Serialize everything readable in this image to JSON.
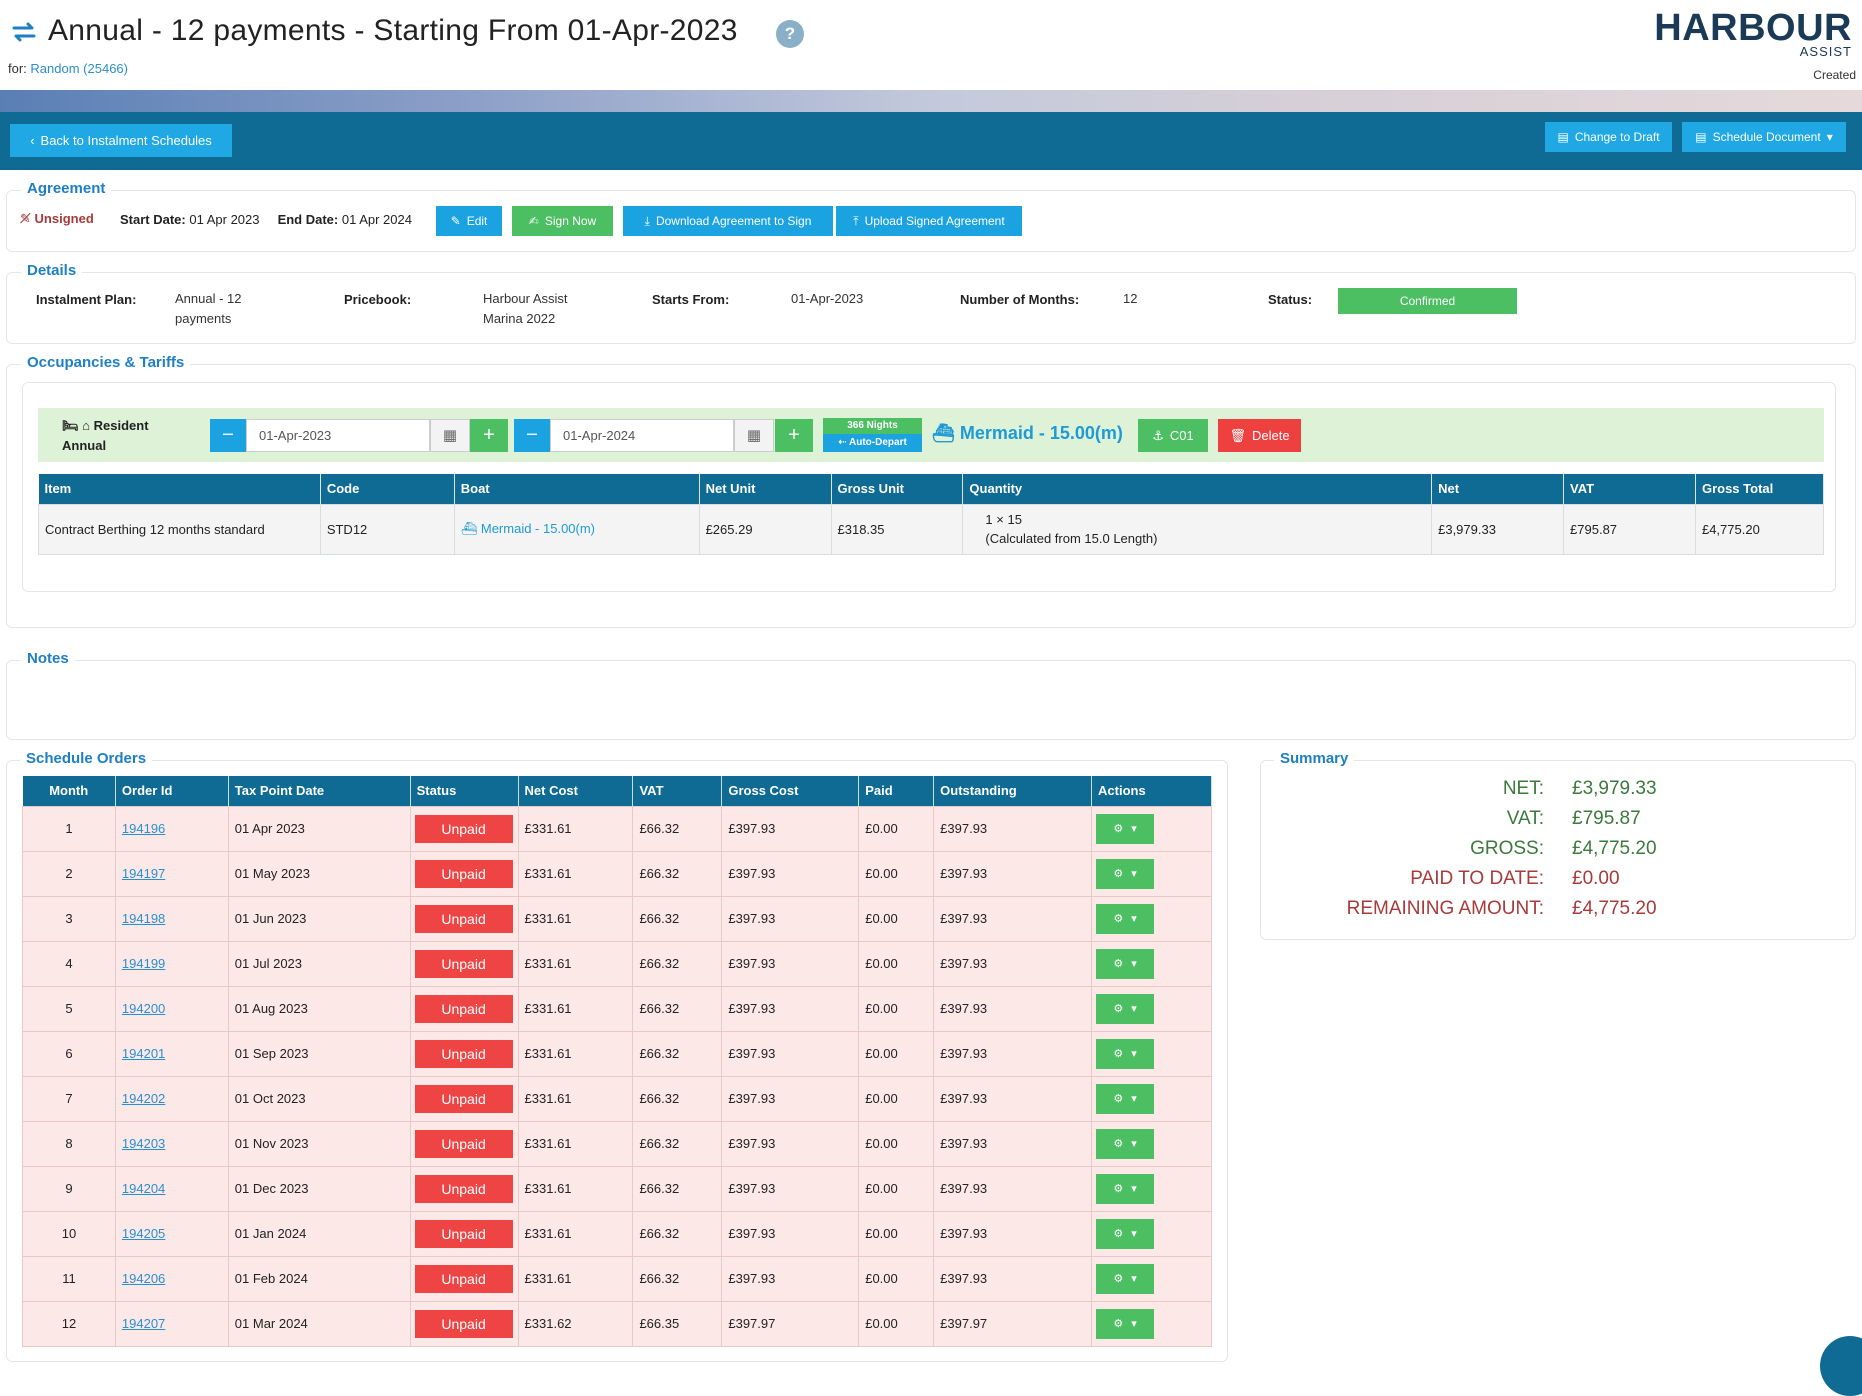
{
  "header": {
    "title": "Annual - 12 payments - Starting From 01-Apr-2023",
    "help_label": "?",
    "for_label": "for:",
    "for_link": "Random (25466)",
    "logo_main": "HARBOUR",
    "logo_sub": "ASSIST",
    "status_text": "Created"
  },
  "toolbar": {
    "back_label": "Back to Instalment Schedules",
    "change_draft_label": "Change to Draft",
    "schedule_document_label": "Schedule Document"
  },
  "agreement": {
    "legend": "Agreement",
    "unsigned_label": "Unsigned",
    "start_label": "Start Date:",
    "start_value": "01 Apr 2023",
    "end_label": "End Date:",
    "end_value": "01 Apr 2024",
    "edit_label": "Edit",
    "sign_now_label": "Sign Now",
    "download_label": "Download Agreement to Sign",
    "upload_label": "Upload Signed Agreement"
  },
  "details": {
    "legend": "Details",
    "plan_label": "Instalment Plan:",
    "plan_value_1": "Annual - 12",
    "plan_value_2": "payments",
    "pricebook_label": "Pricebook:",
    "pricebook_value_1": "Harbour Assist",
    "pricebook_value_2": "Marina 2022",
    "starts_label": "Starts From:",
    "starts_value": "01-Apr-2023",
    "months_label": "Number of Months:",
    "months_value": "12",
    "status_label": "Status:",
    "status_value": "Confirmed"
  },
  "occupancy": {
    "legend": "Occupancies & Tariffs",
    "type_1": "Resident",
    "type_2": "Annual",
    "start_date": "01-Apr-2023",
    "end_date": "01-Apr-2024",
    "nights_label": "366 Nights",
    "auto_depart_label": "Auto-Depart",
    "boat_label": "Mermaid - 15.00(m)",
    "berth_label": "C01",
    "delete_label": "Delete",
    "columns": [
      "Item",
      "Code",
      "Boat",
      "Net Unit",
      "Gross Unit",
      "Quantity",
      "Net",
      "VAT",
      "Gross Total"
    ],
    "row": {
      "item": "Contract Berthing 12 months standard",
      "code": "STD12",
      "boat": "Mermaid - 15.00(m)",
      "net_unit": "£265.29",
      "gross_unit": "£318.35",
      "quantity_1": "1 × 15",
      "quantity_2": "(Calculated from 15.0 Length)",
      "net": "£3,979.33",
      "vat": "£795.87",
      "gross_total": "£4,775.20"
    }
  },
  "notes": {
    "legend": "Notes"
  },
  "schedule": {
    "legend": "Schedule Orders",
    "columns": [
      "Month",
      "Order Id",
      "Tax Point Date",
      "Status",
      "Net Cost",
      "VAT",
      "Gross Cost",
      "Paid",
      "Outstanding",
      "Actions"
    ],
    "rows": [
      {
        "month": "1",
        "order_id": "194196",
        "date": "01 Apr 2023",
        "status": "Unpaid",
        "net": "£331.61",
        "vat": "£66.32",
        "gross": "£397.93",
        "paid": "£0.00",
        "outstanding": "£397.93"
      },
      {
        "month": "2",
        "order_id": "194197",
        "date": "01 May 2023",
        "status": "Unpaid",
        "net": "£331.61",
        "vat": "£66.32",
        "gross": "£397.93",
        "paid": "£0.00",
        "outstanding": "£397.93"
      },
      {
        "month": "3",
        "order_id": "194198",
        "date": "01 Jun 2023",
        "status": "Unpaid",
        "net": "£331.61",
        "vat": "£66.32",
        "gross": "£397.93",
        "paid": "£0.00",
        "outstanding": "£397.93"
      },
      {
        "month": "4",
        "order_id": "194199",
        "date": "01 Jul 2023",
        "status": "Unpaid",
        "net": "£331.61",
        "vat": "£66.32",
        "gross": "£397.93",
        "paid": "£0.00",
        "outstanding": "£397.93"
      },
      {
        "month": "5",
        "order_id": "194200",
        "date": "01 Aug 2023",
        "status": "Unpaid",
        "net": "£331.61",
        "vat": "£66.32",
        "gross": "£397.93",
        "paid": "£0.00",
        "outstanding": "£397.93"
      },
      {
        "month": "6",
        "order_id": "194201",
        "date": "01 Sep 2023",
        "status": "Unpaid",
        "net": "£331.61",
        "vat": "£66.32",
        "gross": "£397.93",
        "paid": "£0.00",
        "outstanding": "£397.93"
      },
      {
        "month": "7",
        "order_id": "194202",
        "date": "01 Oct 2023",
        "status": "Unpaid",
        "net": "£331.61",
        "vat": "£66.32",
        "gross": "£397.93",
        "paid": "£0.00",
        "outstanding": "£397.93"
      },
      {
        "month": "8",
        "order_id": "194203",
        "date": "01 Nov 2023",
        "status": "Unpaid",
        "net": "£331.61",
        "vat": "£66.32",
        "gross": "£397.93",
        "paid": "£0.00",
        "outstanding": "£397.93"
      },
      {
        "month": "9",
        "order_id": "194204",
        "date": "01 Dec 2023",
        "status": "Unpaid",
        "net": "£331.61",
        "vat": "£66.32",
        "gross": "£397.93",
        "paid": "£0.00",
        "outstanding": "£397.93"
      },
      {
        "month": "10",
        "order_id": "194205",
        "date": "01 Jan 2024",
        "status": "Unpaid",
        "net": "£331.61",
        "vat": "£66.32",
        "gross": "£397.93",
        "paid": "£0.00",
        "outstanding": "£397.93"
      },
      {
        "month": "11",
        "order_id": "194206",
        "date": "01 Feb 2024",
        "status": "Unpaid",
        "net": "£331.61",
        "vat": "£66.32",
        "gross": "£397.93",
        "paid": "£0.00",
        "outstanding": "£397.93"
      },
      {
        "month": "12",
        "order_id": "194207",
        "date": "01 Mar 2024",
        "status": "Unpaid",
        "net": "£331.62",
        "vat": "£66.35",
        "gross": "£397.97",
        "paid": "£0.00",
        "outstanding": "£397.97"
      }
    ]
  },
  "summary": {
    "legend": "Summary",
    "net_label": "NET:",
    "net_value": "£3,979.33",
    "vat_label": "VAT:",
    "vat_value": "£795.87",
    "gross_label": "GROSS:",
    "gross_value": "£4,775.20",
    "paid_label": "PAID TO DATE:",
    "paid_value": "£0.00",
    "remaining_label": "REMAINING AMOUNT:",
    "remaining_value": "£4,775.20"
  },
  "colors": {
    "primary": "#0f6b94",
    "accent_blue": "#1fa8e4",
    "success": "#4cbf62",
    "danger": "#ef4444",
    "summary_positive": "#3b7a3b",
    "summary_negative": "#a83a3a"
  }
}
